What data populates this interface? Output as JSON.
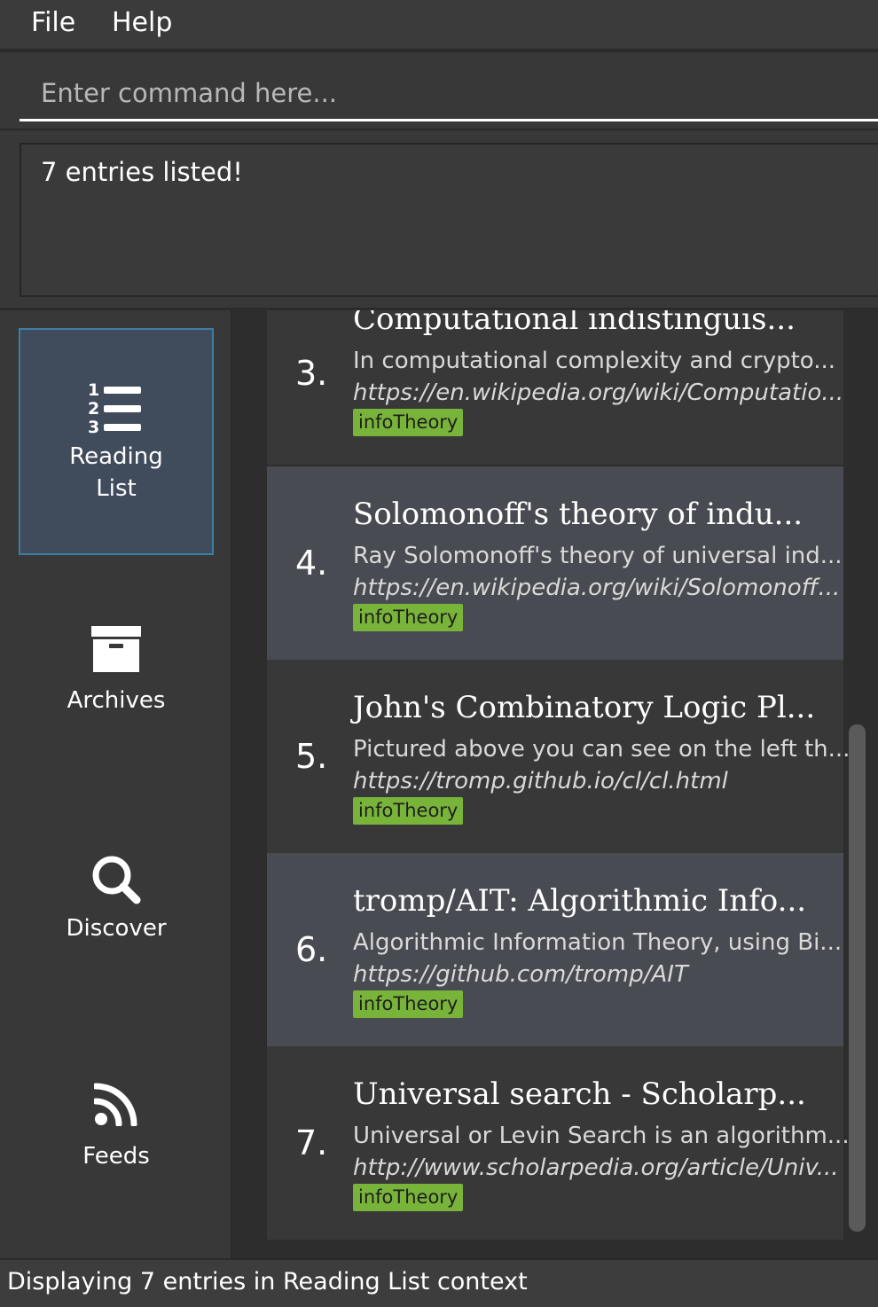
{
  "menu": {
    "file": "File",
    "help": "Help"
  },
  "command": {
    "placeholder": "Enter command here..."
  },
  "result": {
    "text": "7 entries listed!"
  },
  "sidebar": {
    "items": [
      {
        "label_line1": "Reading",
        "label_line2": "List",
        "icon": "numbered-list-icon",
        "active": true
      },
      {
        "label": "Archives",
        "icon": "archive-box-icon"
      },
      {
        "label": "Discover",
        "icon": "search-icon"
      },
      {
        "label": "Feeds",
        "icon": "rss-feed-icon"
      }
    ]
  },
  "entries": [
    {
      "index": "3.",
      "title": "Computational indistinguis...",
      "desc": "In computational complexity and crypto...",
      "url": "https://en.wikipedia.org/wiki/Computatio...",
      "tag": "infoTheory"
    },
    {
      "index": "4.",
      "title": "Solomonoff's theory of indu...",
      "desc": "Ray Solomonoff's theory of universal ind...",
      "url": "https://en.wikipedia.org/wiki/Solomonoff...",
      "tag": "infoTheory"
    },
    {
      "index": "5.",
      "title": "John's Combinatory Logic Pl...",
      "desc": "Pictured above you can see on the left th...",
      "url": "https://tromp.github.io/cl/cl.html",
      "tag": "infoTheory"
    },
    {
      "index": "6.",
      "title": "tromp/AIT: Algorithmic Info...",
      "desc": "Algorithmic Information Theory, using Bi...",
      "url": "https://github.com/tromp/AIT",
      "tag": "infoTheory"
    },
    {
      "index": "7.",
      "title": "Universal search - Scholarp...",
      "desc": "Universal or Levin Search is an algorithm...",
      "url": "http://www.scholarpedia.org/article/Univ...",
      "tag": "infoTheory"
    }
  ],
  "status": {
    "text": "Displaying 7 entries in Reading List context"
  },
  "colors": {
    "tag": "#79b43a",
    "active_nav": "#404b5c",
    "active_border": "#3a7fa3"
  }
}
